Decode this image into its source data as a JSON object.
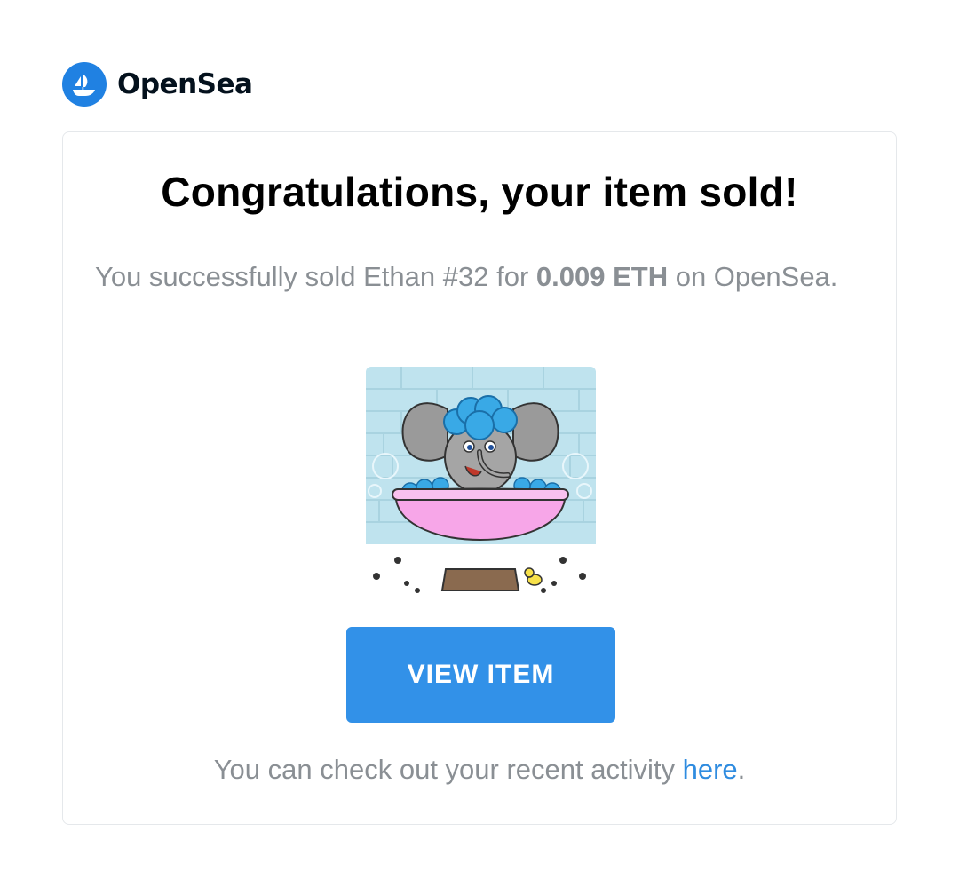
{
  "brand": {
    "name": "OpenSea",
    "accent_color": "#2081e2",
    "logo_icon": "opensea-ship-icon"
  },
  "email": {
    "title": "Congratulations, your item sold!",
    "message_prefix": "You successfully sold Ethan #32 for ",
    "price": "0.009 ETH",
    "message_suffix": " on OpenSea.",
    "nft_image_icon": "nft-elephant-in-bathtub-image",
    "view_button_label": "VIEW ITEM",
    "button_color": "#3291e8",
    "footer_prefix": "You can check out your recent activity ",
    "footer_link": "here",
    "footer_suffix": "."
  }
}
